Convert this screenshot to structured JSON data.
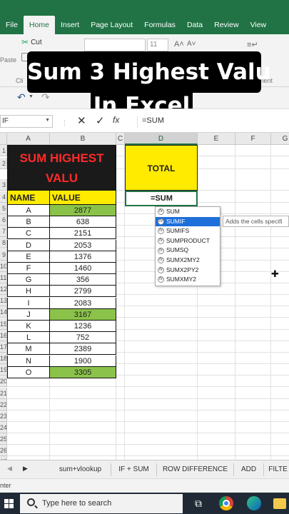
{
  "ribbon": {
    "tabs": [
      "File",
      "Home",
      "Insert",
      "Page Layout",
      "Formulas",
      "Data",
      "Review",
      "View"
    ],
    "active_tab": "Home",
    "cut_label": "Cut",
    "paste_label": "Paste",
    "clipboard_label": "Cli",
    "font_size": "11",
    "alignment_label": "gnment"
  },
  "overlay": {
    "line1": "Sum 3 Highest Valu",
    "line2": "In Excel"
  },
  "formula_bar": {
    "name_box": "IF",
    "formula": "=SUM"
  },
  "columns": [
    "A",
    "B",
    "C",
    "D",
    "E",
    "F",
    "G"
  ],
  "selected_column": "D",
  "row_numbers": [
    "1",
    "2",
    "3",
    "4",
    "5",
    "6",
    "7",
    "8",
    "9",
    "10",
    "11",
    "12",
    "13",
    "14",
    "15",
    "16",
    "17",
    "18",
    "19",
    "20",
    "21",
    "22",
    "23",
    "24",
    "25",
    "26",
    "27"
  ],
  "table": {
    "title": "SUM HIGHEST VALU",
    "headers": {
      "name": "NAME",
      "value": "VALUE"
    },
    "rows": [
      {
        "name": "A",
        "value": "2877",
        "highlight": true
      },
      {
        "name": "B",
        "value": "638",
        "highlight": false
      },
      {
        "name": "C",
        "value": "2151",
        "highlight": false
      },
      {
        "name": "D",
        "value": "2053",
        "highlight": false
      },
      {
        "name": "E",
        "value": "1376",
        "highlight": false
      },
      {
        "name": "F",
        "value": "1460",
        "highlight": false
      },
      {
        "name": "G",
        "value": "356",
        "highlight": false
      },
      {
        "name": "H",
        "value": "2799",
        "highlight": false
      },
      {
        "name": "I",
        "value": "2083",
        "highlight": false
      },
      {
        "name": "J",
        "value": "3167",
        "highlight": true
      },
      {
        "name": "K",
        "value": "1236",
        "highlight": false
      },
      {
        "name": "L",
        "value": "752",
        "highlight": false
      },
      {
        "name": "M",
        "value": "2389",
        "highlight": false
      },
      {
        "name": "N",
        "value": "1900",
        "highlight": false
      },
      {
        "name": "O",
        "value": "3305",
        "highlight": true
      }
    ]
  },
  "total": {
    "label": "TOTAL",
    "cell_value": "=SUM"
  },
  "autocomplete": {
    "items": [
      "SUM",
      "SUMIF",
      "SUMIFS",
      "SUMPRODUCT",
      "SUMSQ",
      "SUMX2MY2",
      "SUMX2PY2",
      "SUMXMY2"
    ],
    "selected": "SUMIF",
    "tooltip": "Adds the cells specifi"
  },
  "sheet_tabs": [
    "sum+vlookup",
    "IF + SUM",
    "ROW DIFFERENCE",
    "ADD",
    "FILTE"
  ],
  "status": {
    "mode": "nter"
  },
  "taskbar": {
    "search_placeholder": "Type here to search"
  },
  "colors": {
    "excel_green": "#217346",
    "header_yellow": "#ffeb00",
    "highlight_green": "#8bc34a",
    "title_red": "#ff2a2a",
    "selection_blue": "#1e6fd9"
  }
}
